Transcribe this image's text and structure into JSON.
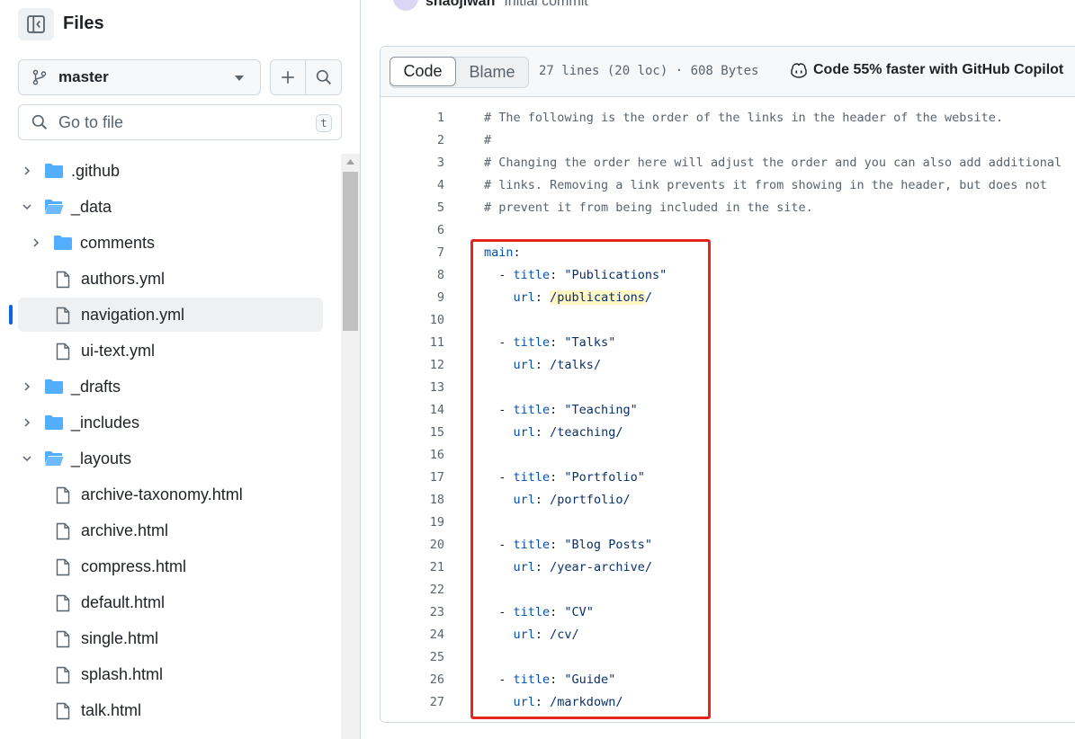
{
  "sidebar": {
    "title": "Files",
    "branch": "master",
    "goto_placeholder": "Go to file",
    "goto_shortcut": "t",
    "tree": [
      {
        "label": ".github",
        "type": "folder",
        "level": 0,
        "expanded": false
      },
      {
        "label": "_data",
        "type": "folder",
        "level": 0,
        "expanded": true
      },
      {
        "label": "comments",
        "type": "folder",
        "level": 1,
        "expanded": false
      },
      {
        "label": "authors.yml",
        "type": "file",
        "level": 1
      },
      {
        "label": "navigation.yml",
        "type": "file",
        "level": 1,
        "active": true
      },
      {
        "label": "ui-text.yml",
        "type": "file",
        "level": 1
      },
      {
        "label": "_drafts",
        "type": "folder",
        "level": 0,
        "expanded": false
      },
      {
        "label": "_includes",
        "type": "folder",
        "level": 0,
        "expanded": false
      },
      {
        "label": "_layouts",
        "type": "folder",
        "level": 0,
        "expanded": true
      },
      {
        "label": "archive-taxonomy.html",
        "type": "file",
        "level": 1
      },
      {
        "label": "archive.html",
        "type": "file",
        "level": 1
      },
      {
        "label": "compress.html",
        "type": "file",
        "level": 1
      },
      {
        "label": "default.html",
        "type": "file",
        "level": 1
      },
      {
        "label": "single.html",
        "type": "file",
        "level": 1
      },
      {
        "label": "splash.html",
        "type": "file",
        "level": 1
      },
      {
        "label": "talk.html",
        "type": "file",
        "level": 1
      }
    ]
  },
  "commit": {
    "user": "shaojiwan",
    "message": "Initial commit"
  },
  "file": {
    "tab_code": "Code",
    "tab_blame": "Blame",
    "meta": "27 lines (20 loc) · 608 Bytes",
    "copilot": "Code 55% faster with GitHub Copilot",
    "lines": [
      {
        "n": "1",
        "tokens": [
          {
            "t": "# The following is the order of the links in the header of the website.",
            "c": "c-comment"
          }
        ]
      },
      {
        "n": "2",
        "tokens": [
          {
            "t": "#",
            "c": "c-comment"
          }
        ]
      },
      {
        "n": "3",
        "tokens": [
          {
            "t": "# Changing the order here will adjust the order and you can also add additional",
            "c": "c-comment"
          }
        ]
      },
      {
        "n": "4",
        "tokens": [
          {
            "t": "# links. Removing a link prevents it from showing in the header, but does not",
            "c": "c-comment"
          }
        ]
      },
      {
        "n": "5",
        "tokens": [
          {
            "t": "# prevent it from being included in the site.",
            "c": "c-comment"
          }
        ]
      },
      {
        "n": "6",
        "tokens": []
      },
      {
        "n": "7",
        "tokens": [
          {
            "t": "main",
            "c": "c-key"
          },
          {
            "t": ":",
            "c": ""
          }
        ]
      },
      {
        "n": "8",
        "tokens": [
          {
            "t": "  - ",
            "c": ""
          },
          {
            "t": "title",
            "c": "c-key"
          },
          {
            "t": ": ",
            "c": ""
          },
          {
            "t": "\"Publications\"",
            "c": "c-str"
          }
        ]
      },
      {
        "n": "9",
        "tokens": [
          {
            "t": "    ",
            "c": ""
          },
          {
            "t": "url",
            "c": "c-key"
          },
          {
            "t": ": ",
            "c": ""
          },
          {
            "t": "/publications",
            "c": "c-plain hl"
          },
          {
            "t": "/",
            "c": "c-plain"
          }
        ]
      },
      {
        "n": "10",
        "tokens": []
      },
      {
        "n": "11",
        "tokens": [
          {
            "t": "  - ",
            "c": ""
          },
          {
            "t": "title",
            "c": "c-key"
          },
          {
            "t": ": ",
            "c": ""
          },
          {
            "t": "\"Talks\"",
            "c": "c-str"
          }
        ]
      },
      {
        "n": "12",
        "tokens": [
          {
            "t": "    ",
            "c": ""
          },
          {
            "t": "url",
            "c": "c-key"
          },
          {
            "t": ": ",
            "c": ""
          },
          {
            "t": "/talks/",
            "c": "c-plain"
          }
        ]
      },
      {
        "n": "13",
        "tokens": []
      },
      {
        "n": "14",
        "tokens": [
          {
            "t": "  - ",
            "c": ""
          },
          {
            "t": "title",
            "c": "c-key"
          },
          {
            "t": ": ",
            "c": ""
          },
          {
            "t": "\"Teaching\"",
            "c": "c-str"
          }
        ]
      },
      {
        "n": "15",
        "tokens": [
          {
            "t": "    ",
            "c": ""
          },
          {
            "t": "url",
            "c": "c-key"
          },
          {
            "t": ": ",
            "c": ""
          },
          {
            "t": "/teaching/",
            "c": "c-plain"
          }
        ]
      },
      {
        "n": "16",
        "tokens": []
      },
      {
        "n": "17",
        "tokens": [
          {
            "t": "  - ",
            "c": ""
          },
          {
            "t": "title",
            "c": "c-key"
          },
          {
            "t": ": ",
            "c": ""
          },
          {
            "t": "\"Portfolio\"",
            "c": "c-str"
          }
        ]
      },
      {
        "n": "18",
        "tokens": [
          {
            "t": "    ",
            "c": ""
          },
          {
            "t": "url",
            "c": "c-key"
          },
          {
            "t": ": ",
            "c": ""
          },
          {
            "t": "/portfolio/",
            "c": "c-plain"
          }
        ]
      },
      {
        "n": "19",
        "tokens": []
      },
      {
        "n": "20",
        "tokens": [
          {
            "t": "  - ",
            "c": ""
          },
          {
            "t": "title",
            "c": "c-key"
          },
          {
            "t": ": ",
            "c": ""
          },
          {
            "t": "\"Blog Posts\"",
            "c": "c-str"
          }
        ]
      },
      {
        "n": "21",
        "tokens": [
          {
            "t": "    ",
            "c": ""
          },
          {
            "t": "url",
            "c": "c-key"
          },
          {
            "t": ": ",
            "c": ""
          },
          {
            "t": "/year-archive/",
            "c": "c-plain"
          }
        ]
      },
      {
        "n": "22",
        "tokens": []
      },
      {
        "n": "23",
        "tokens": [
          {
            "t": "  - ",
            "c": ""
          },
          {
            "t": "title",
            "c": "c-key"
          },
          {
            "t": ": ",
            "c": ""
          },
          {
            "t": "\"CV\"",
            "c": "c-str"
          }
        ]
      },
      {
        "n": "24",
        "tokens": [
          {
            "t": "    ",
            "c": ""
          },
          {
            "t": "url",
            "c": "c-key"
          },
          {
            "t": ": ",
            "c": ""
          },
          {
            "t": "/cv/",
            "c": "c-plain"
          }
        ]
      },
      {
        "n": "25",
        "tokens": []
      },
      {
        "n": "26",
        "tokens": [
          {
            "t": "  - ",
            "c": ""
          },
          {
            "t": "title",
            "c": "c-key"
          },
          {
            "t": ": ",
            "c": ""
          },
          {
            "t": "\"Guide\"",
            "c": "c-str"
          }
        ]
      },
      {
        "n": "27",
        "tokens": [
          {
            "t": "    ",
            "c": ""
          },
          {
            "t": "url",
            "c": "c-key"
          },
          {
            "t": ": ",
            "c": ""
          },
          {
            "t": "/markdown/",
            "c": "c-plain"
          }
        ]
      }
    ]
  },
  "colors": {
    "accent": "#0969da",
    "folder": "#54aeff",
    "highlight_box": "#e5251e",
    "search_highlight": "#fff8c5"
  }
}
